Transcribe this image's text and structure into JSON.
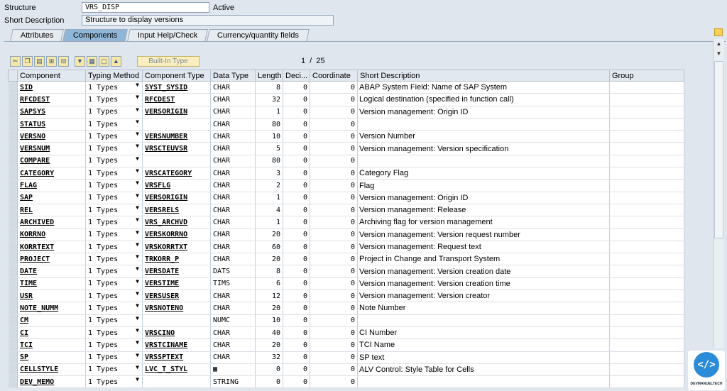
{
  "header": {
    "structure_label": "Structure",
    "structure_value": "VRS_DISP",
    "status": "Active",
    "short_desc_label": "Short Description",
    "short_desc_value": "Structure to display versions"
  },
  "tabs": [
    {
      "label": "Attributes",
      "active": false
    },
    {
      "label": "Components",
      "active": true
    },
    {
      "label": "Input Help/Check",
      "active": false
    },
    {
      "label": "Currency/quantity fields",
      "active": false
    }
  ],
  "toolbar": {
    "buttons": [
      "cut-icon",
      "copy-icon",
      "paste-icon",
      "insert-row-icon",
      "delete-row-icon",
      "find-icon",
      "select-all-icon",
      "deselect-all-icon",
      "move-up-icon"
    ],
    "builtin_label": "Built-In Type",
    "pager": "1 / 25"
  },
  "columns": [
    "Component",
    "Typing Method",
    "Component Type",
    "Data Type",
    "Length",
    "Deci...",
    "Coordinate",
    "Short Description",
    "Group"
  ],
  "rows": [
    {
      "comp": "SID",
      "typ": "1 Types",
      "ctype": "SYST_SYSID",
      "dtype": "CHAR",
      "len": "8",
      "dec": "0",
      "coord": "0",
      "desc": "ABAP System Field: Name of SAP System"
    },
    {
      "comp": "RFCDEST",
      "typ": "1 Types",
      "ctype": "RFCDEST",
      "dtype": "CHAR",
      "len": "32",
      "dec": "0",
      "coord": "0",
      "desc": "Logical destination (specified in function call)"
    },
    {
      "comp": "SAPSYS",
      "typ": "1 Types",
      "ctype": "VERSORIGIN",
      "dtype": "CHAR",
      "len": "1",
      "dec": "0",
      "coord": "0",
      "desc": "Version management: Origin ID"
    },
    {
      "comp": "STATUS",
      "typ": "1 Types",
      "ctype": "",
      "dtype": "CHAR",
      "len": "80",
      "dec": "0",
      "coord": "0",
      "desc": ""
    },
    {
      "comp": "VERSNO",
      "typ": "1 Types",
      "ctype": "VERSNUMBER",
      "dtype": "CHAR",
      "len": "10",
      "dec": "0",
      "coord": "0",
      "desc": "Version Number"
    },
    {
      "comp": "VERSNUM",
      "typ": "1 Types",
      "ctype": "VRSCTEUVSR",
      "dtype": "CHAR",
      "len": "5",
      "dec": "0",
      "coord": "0",
      "desc": "Version management: Version specification"
    },
    {
      "comp": "COMPARE",
      "typ": "1 Types",
      "ctype": "",
      "dtype": "CHAR",
      "len": "80",
      "dec": "0",
      "coord": "0",
      "desc": ""
    },
    {
      "comp": "CATEGORY",
      "typ": "1 Types",
      "ctype": "VRSCATEGORY",
      "dtype": "CHAR",
      "len": "3",
      "dec": "0",
      "coord": "0",
      "desc": "Category Flag"
    },
    {
      "comp": "FLAG",
      "typ": "1 Types",
      "ctype": "VRSFLG",
      "dtype": "CHAR",
      "len": "2",
      "dec": "0",
      "coord": "0",
      "desc": "Flag"
    },
    {
      "comp": "SAP",
      "typ": "1 Types",
      "ctype": "VERSORIGIN",
      "dtype": "CHAR",
      "len": "1",
      "dec": "0",
      "coord": "0",
      "desc": "Version management: Origin ID"
    },
    {
      "comp": "REL",
      "typ": "1 Types",
      "ctype": "VERSRELS",
      "dtype": "CHAR",
      "len": "4",
      "dec": "0",
      "coord": "0",
      "desc": "Version management: Release"
    },
    {
      "comp": "ARCHIVED",
      "typ": "1 Types",
      "ctype": "VRS_ARCHVD",
      "dtype": "CHAR",
      "len": "1",
      "dec": "0",
      "coord": "0",
      "desc": "Archiving flag for version management"
    },
    {
      "comp": "KORRNO",
      "typ": "1 Types",
      "ctype": "VERSKORRNO",
      "dtype": "CHAR",
      "len": "20",
      "dec": "0",
      "coord": "0",
      "desc": "Version management: Version request number"
    },
    {
      "comp": "KORRTEXT",
      "typ": "1 Types",
      "ctype": "VRSKORRTXT",
      "dtype": "CHAR",
      "len": "60",
      "dec": "0",
      "coord": "0",
      "desc": "Version management: Request text"
    },
    {
      "comp": "PROJECT",
      "typ": "1 Types",
      "ctype": "TRKORR_P",
      "dtype": "CHAR",
      "len": "20",
      "dec": "0",
      "coord": "0",
      "desc": "Project in Change and Transport System"
    },
    {
      "comp": "DATE",
      "typ": "1 Types",
      "ctype": "VERSDATE",
      "dtype": "DATS",
      "len": "8",
      "dec": "0",
      "coord": "0",
      "desc": "Version management: Version creation date"
    },
    {
      "comp": "TIME",
      "typ": "1 Types",
      "ctype": "VERSTIME",
      "dtype": "TIMS",
      "len": "6",
      "dec": "0",
      "coord": "0",
      "desc": "Version management: Version creation time"
    },
    {
      "comp": "USR",
      "typ": "1 Types",
      "ctype": "VERSUSER",
      "dtype": "CHAR",
      "len": "12",
      "dec": "0",
      "coord": "0",
      "desc": "Version management: Version creator"
    },
    {
      "comp": "NOTE_NUMM",
      "typ": "1 Types",
      "ctype": "VRSNOTENO",
      "dtype": "CHAR",
      "len": "20",
      "dec": "0",
      "coord": "0",
      "desc": "Note Number"
    },
    {
      "comp": "CM",
      "typ": "1 Types",
      "ctype": "",
      "dtype": "NUMC",
      "len": "10",
      "dec": "0",
      "coord": "0",
      "desc": ""
    },
    {
      "comp": "CI",
      "typ": "1 Types",
      "ctype": "VRSCINO",
      "dtype": "CHAR",
      "len": "40",
      "dec": "0",
      "coord": "0",
      "desc": "CI Number"
    },
    {
      "comp": "TCI",
      "typ": "1 Types",
      "ctype": "VRSTCINAME",
      "dtype": "CHAR",
      "len": "20",
      "dec": "0",
      "coord": "0",
      "desc": "TCI Name"
    },
    {
      "comp": "SP",
      "typ": "1 Types",
      "ctype": "VRSSPTEXT",
      "dtype": "CHAR",
      "len": "32",
      "dec": "0",
      "coord": "0",
      "desc": "SP text"
    },
    {
      "comp": "CELLSTYLE",
      "typ": "1 Types",
      "ctype": "LVC_T_STYL",
      "dtype": "table-icon",
      "len": "0",
      "dec": "0",
      "coord": "0",
      "desc": "ALV Control: Style Table for Cells"
    },
    {
      "comp": "DEV_MEMO",
      "typ": "1 Types",
      "ctype": "",
      "dtype": "STRING",
      "len": "0",
      "dec": "0",
      "coord": "0",
      "desc": ""
    }
  ],
  "watermark": {
    "text": "DEVMANUELTECH",
    "glyph": "</>"
  }
}
